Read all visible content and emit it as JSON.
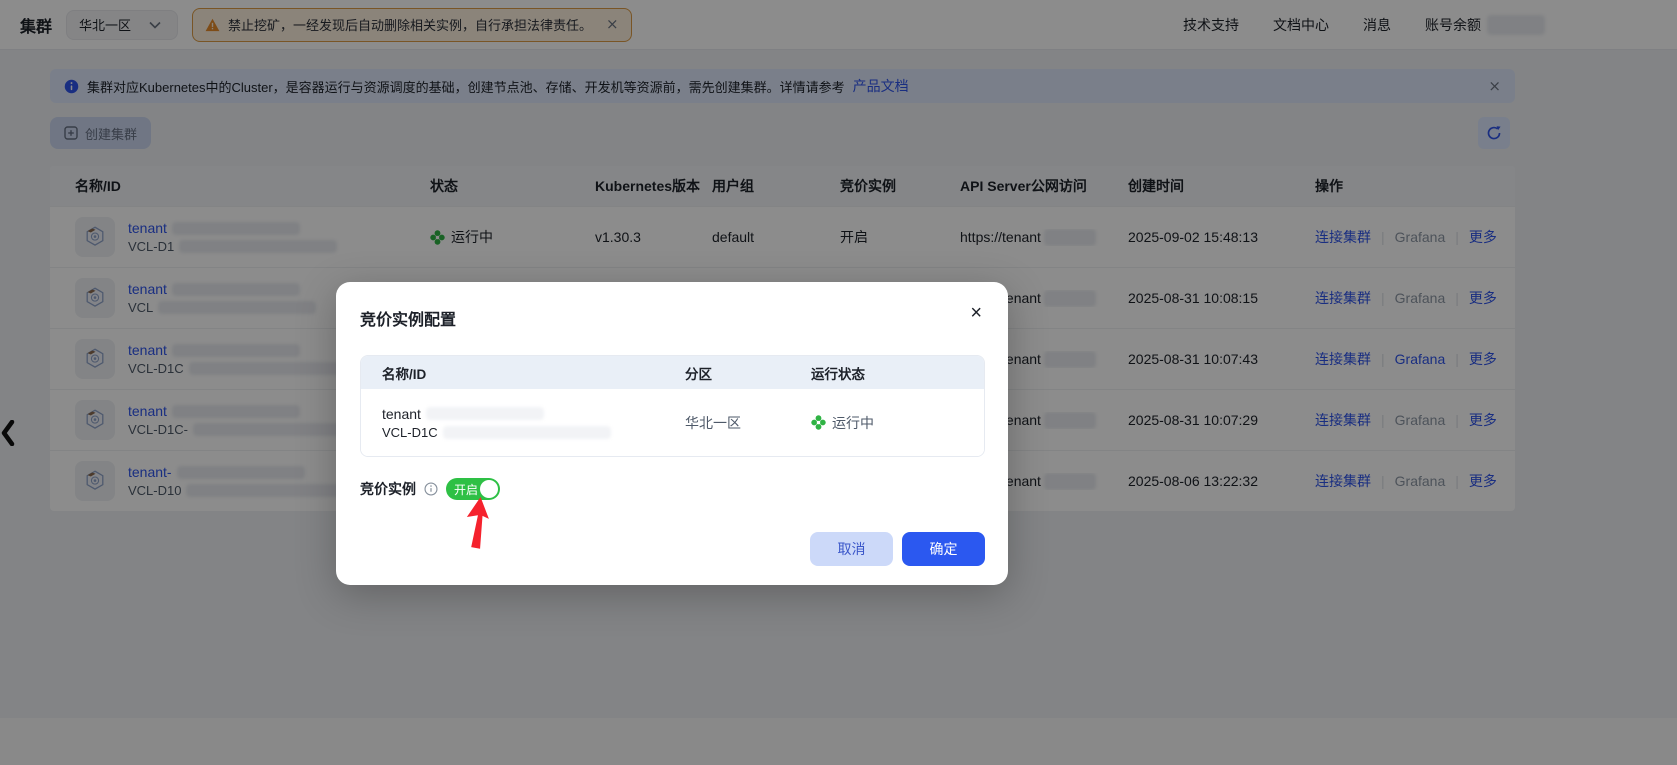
{
  "topbar": {
    "title": "集群",
    "region_selector": {
      "value": "华北一区"
    },
    "warning_banner": {
      "text": "禁止挖矿，一经发现后自动删除相关实例，自行承担法律责任。"
    },
    "nav": {
      "support": "技术支持",
      "docs": "文档中心",
      "messages": "消息",
      "balance": "账号余额"
    }
  },
  "info_banner": {
    "text": "集群对应Kubernetes中的Cluster，是容器运行与资源调度的基础，创建节点池、存储、开发机等资源前，需先创建集群。详情请参考",
    "link_label": "产品文档"
  },
  "toolbar": {
    "create_label": "创建集群"
  },
  "table": {
    "columns": [
      "名称/ID",
      "状态",
      "Kubernetes版本",
      "用户组",
      "竞价实例",
      "API Server公网访问",
      "创建时间",
      "操作"
    ],
    "actions": {
      "connect": "连接集群",
      "grafana": "Grafana",
      "more": "更多"
    },
    "rows": [
      {
        "name": "tenant",
        "id": "VCL-D1",
        "status": "运行中",
        "version": "v1.30.3",
        "group": "default",
        "spot": "开启",
        "api": "https://tenant",
        "created": "2025-09-02 15:48:13",
        "grafana_active": false
      },
      {
        "name": "tenant",
        "id": "VCL",
        "status": "",
        "version": "",
        "group": "",
        "spot": "",
        "api": "https://tenant",
        "created": "2025-08-31 10:08:15",
        "grafana_active": false
      },
      {
        "name": "tenant",
        "id": "VCL-D1C",
        "status": "",
        "version": "",
        "group": "",
        "spot": "",
        "api": "https://tenant",
        "created": "2025-08-31 10:07:43",
        "grafana_active": true
      },
      {
        "name": "tenant",
        "id": "VCL-D1C-",
        "status": "",
        "version": "",
        "group": "",
        "spot": "",
        "api": "https://tenant",
        "created": "2025-08-31 10:07:29",
        "grafana_active": false
      },
      {
        "name": "tenant-",
        "id": "VCL-D10",
        "status": "",
        "version": "",
        "group": "",
        "spot": "",
        "api": "https://tenant",
        "created": "2025-08-06 13:22:32",
        "grafana_active": false
      }
    ]
  },
  "modal": {
    "title": "竞价实例配置",
    "columns": [
      "名称/ID",
      "分区",
      "运行状态"
    ],
    "row": {
      "name": "tenant",
      "id": "VCL-D1C",
      "zone": "华北一区",
      "status": "运行中"
    },
    "spot_label": "竞价实例",
    "toggle_label": "开启",
    "cancel_label": "取消",
    "confirm_label": "确定"
  },
  "icons": {
    "close_glyph": "×"
  },
  "colors": {
    "accent_blue": "#2f54eb",
    "success_green": "#2fb344",
    "toggle_green": "#2ec045",
    "warning_orange": "#ff9a2e",
    "arrow_red": "#f5222d"
  }
}
